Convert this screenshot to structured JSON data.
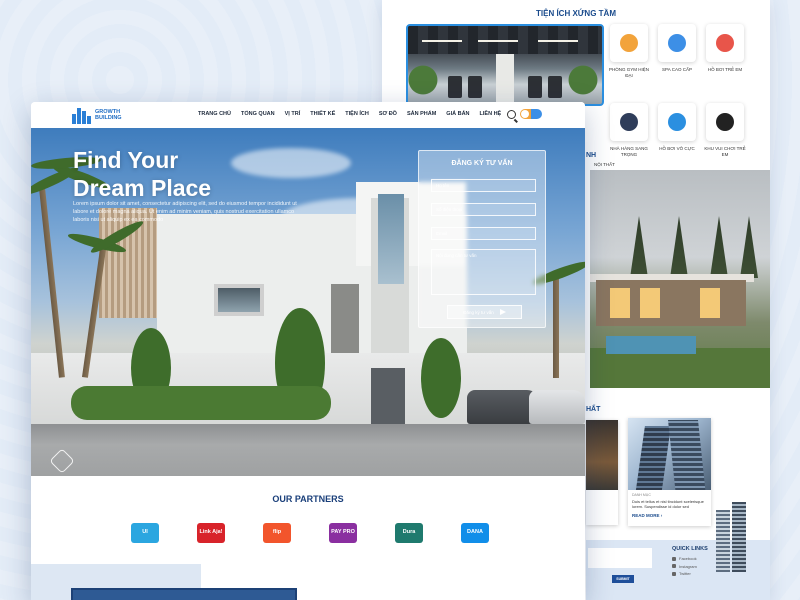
{
  "back_page": {
    "amenities_title": "TIỆN ÍCH XỨNG TẦM",
    "amenities": [
      {
        "label": "PHÒNG GYM HIỆN ĐẠI",
        "icon": "dumbbell-icon",
        "color": "#f2a33b"
      },
      {
        "label": "SPA CAO CẤP",
        "icon": "bathtub-icon",
        "color": "#3d8fe6"
      },
      {
        "label": "HỒ BƠI TRẺ EM",
        "icon": "house-pool-icon",
        "color": "#e8554a"
      },
      {
        "label": "NHÀ HÀNG SANG TRỌNG",
        "icon": "dining-icon",
        "color": "#2f3d5a"
      },
      {
        "label": "HỒ BƠI VÔ CỰC",
        "icon": "wave-icon",
        "color": "#2b8fe0"
      },
      {
        "label": "KHU VUI CHƠI TRẺ EM",
        "icon": "ball-icon",
        "color": "#222222"
      }
    ],
    "section2_title_partial": "NH",
    "section2_tab": "NỘI THẤT",
    "section3_title_partial": "HẤT",
    "news": {
      "tag": "DANH MỤC",
      "text": "Duis et tellus et nisl tincidunt scelerisque lorem. Suspendisse id dolor sed",
      "more_label": "READ MORE"
    },
    "footer": {
      "submit_label": "SUBMIT",
      "quick_links_title": "QUICK LINKS",
      "quick_links": [
        "Facebook",
        "Instagram",
        "Twitter"
      ]
    }
  },
  "front_page": {
    "brand": {
      "line1": "GROWTH",
      "line2": "BUILDING"
    },
    "nav": [
      "TRANG CHỦ",
      "TỔNG QUAN",
      "VỊ TRÍ",
      "THIẾT KẾ",
      "TIỆN ÍCH",
      "SƠ ĐỒ",
      "SẢN PHẨM",
      "GIÁ BÁN",
      "LIÊN HỆ"
    ],
    "hero": {
      "title_line1": "Find Your",
      "title_line2": "Dream Place",
      "description": "Lorem ipsum dolor sit amet, consectetur adipiscing elit, sed do eiusmod tempor incididunt ut labore et dolore magna aliqua. Ut enim ad minim veniam, quis nostrud exercitation ullamco laboris nisi ut aliquip ex ea commodo"
    },
    "form": {
      "title": "ĐĂNG KÝ TƯ VẤN",
      "name_placeholder": "Họ tên",
      "phone_placeholder": "Số điện thoại",
      "email_placeholder": "Email",
      "message_placeholder": "Nội dung cần tư vấn",
      "submit_label": "Đăng ký tư vấn"
    },
    "partners_title": "OUR PARTNERS",
    "partners": [
      {
        "name": "UI",
        "color": "#2ba6e0"
      },
      {
        "name": "Link Aja!",
        "color": "#d8232a"
      },
      {
        "name": "flip",
        "color": "#f2552c"
      },
      {
        "name": "PAY PRO",
        "color": "#8a2fa0"
      },
      {
        "name": "Dura",
        "color": "#1f7a6e"
      },
      {
        "name": "DANA",
        "color": "#118ee9"
      }
    ],
    "colors": {
      "brand": "#1f6dc4",
      "title": "#1a3f7a"
    }
  }
}
